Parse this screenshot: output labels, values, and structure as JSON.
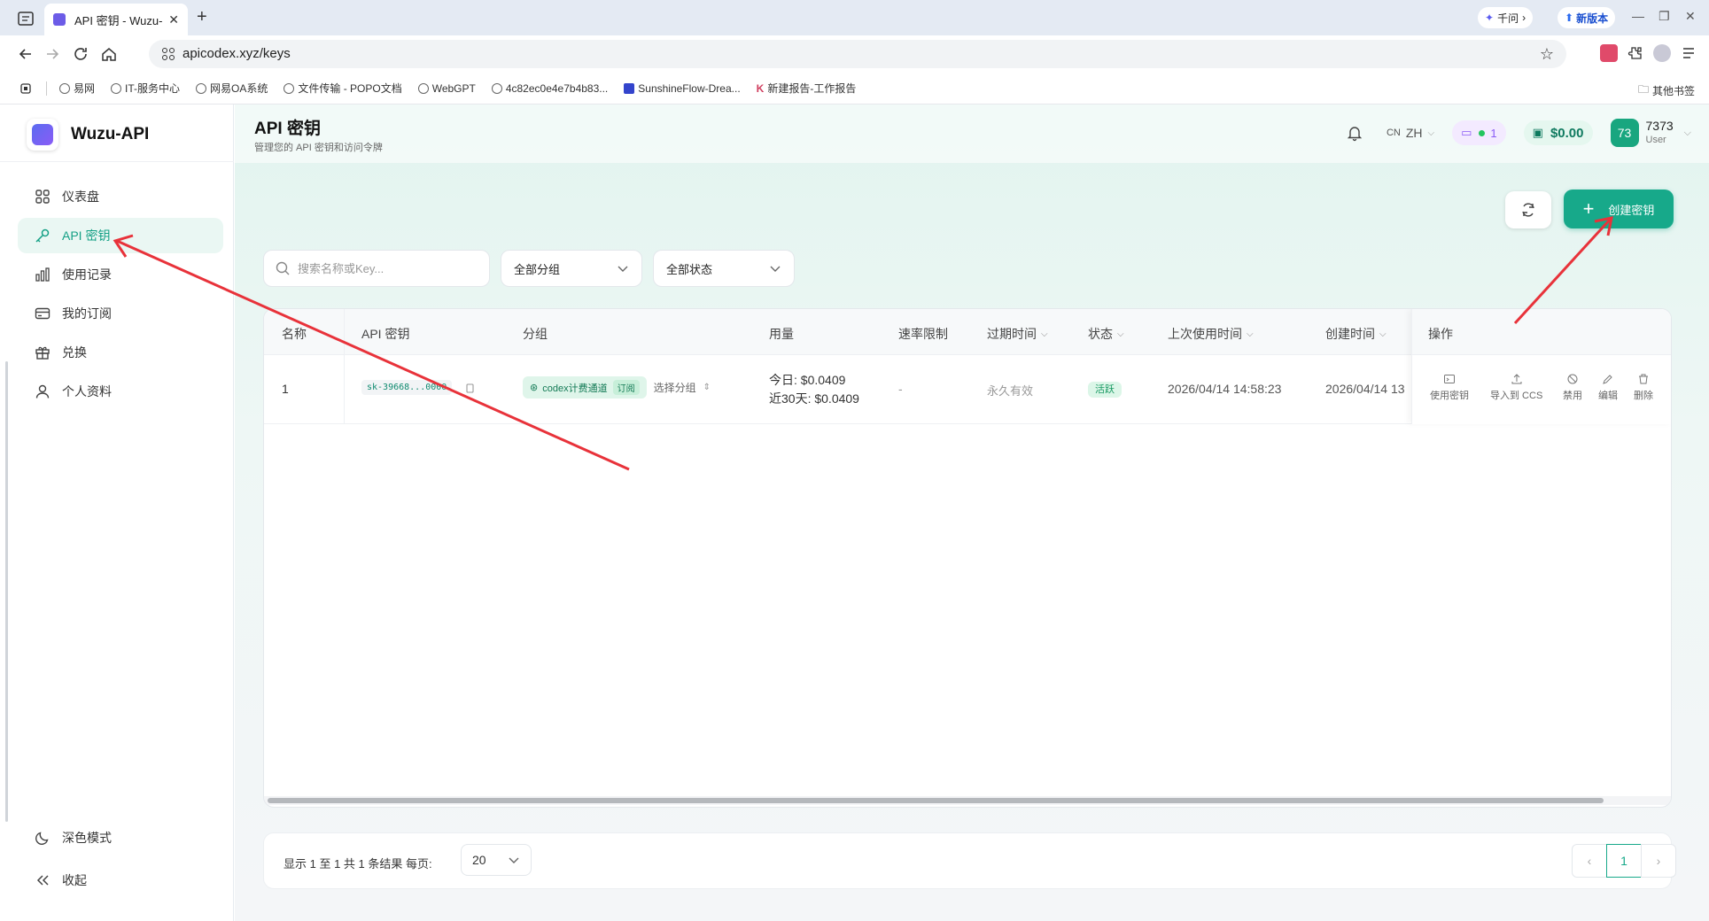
{
  "browser": {
    "tab_title": "API 密钥 - Wuzu-",
    "url": "apicodex.xyz/keys",
    "qianwen": "千问",
    "new_version": "新版本",
    "bookmarks": [
      "易网",
      "IT-服务中心",
      "网易OA系统",
      "文件传输 - POPO文档",
      "WebGPT",
      "4c82ec0e4e7b4b83...",
      "SunshineFlow-Drea...",
      "新建报告-工作报告"
    ],
    "other_bookmarks": "其他书签"
  },
  "sidebar": {
    "brand": "Wuzu-API",
    "items": [
      {
        "label": "仪表盘",
        "icon": "dashboard-icon"
      },
      {
        "label": "API 密钥",
        "icon": "key-icon",
        "active": true
      },
      {
        "label": "使用记录",
        "icon": "bar-chart-icon"
      },
      {
        "label": "我的订阅",
        "icon": "card-icon"
      },
      {
        "label": "兑换",
        "icon": "gift-icon"
      },
      {
        "label": "个人资料",
        "icon": "user-icon"
      }
    ],
    "dark_mode": "深色模式",
    "collapse": "收起"
  },
  "header": {
    "title": "API 密钥",
    "subtitle": "管理您的 API 密钥和访问令牌",
    "lang_flag": "CN",
    "lang": "ZH",
    "sub_count": "1",
    "balance": "$0.00",
    "avatar": "73",
    "username": "7373",
    "role": "User"
  },
  "toolbar": {
    "create_label": "创建密钥",
    "search_placeholder": "搜索名称或Key...",
    "group_filter": "全部分组",
    "status_filter": "全部状态"
  },
  "table": {
    "columns": [
      "名称",
      "API 密钥",
      "分组",
      "用量",
      "速率限制",
      "过期时间",
      "状态",
      "上次使用时间",
      "创建时间",
      "操作"
    ],
    "rows": [
      {
        "name": "1",
        "key": "sk-39668...0000",
        "group": "codex计费通道",
        "group_tag": "订阅",
        "group_select": "选择分组",
        "usage_today": "今日: $0.0409",
        "usage_30d": "近30天: $0.0409",
        "rate_limit": "-",
        "expires": "永久有效",
        "status": "活跃",
        "last_used": "2026/04/14 14:58:23",
        "created": "2026/04/14 13"
      }
    ],
    "actions": [
      "使用密钥",
      "导入到 CCS",
      "禁用",
      "编辑",
      "删除"
    ]
  },
  "pagination": {
    "info": "显示 1 至 1 共 1 条结果",
    "per_page_label": "每页:",
    "per_page": "20",
    "current_page": "1"
  },
  "annotation_color": "#e8323a"
}
